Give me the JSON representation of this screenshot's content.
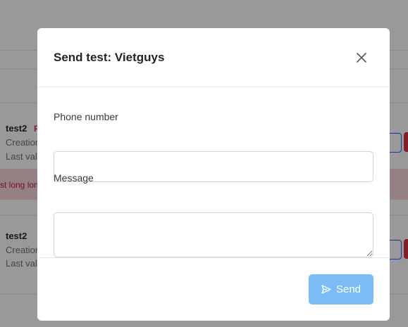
{
  "background": {
    "cards": [
      {
        "title": "test2",
        "tag": "F",
        "meta": [
          "Creation",
          "Last val"
        ],
        "error": "st long lon"
      },
      {
        "title": "test2",
        "meta": [
          "Creation",
          "Last val"
        ]
      }
    ]
  },
  "modal": {
    "title": "Send test: Vietguys",
    "close_icon": "close-icon",
    "phone": {
      "label": "Phone number",
      "value": "",
      "placeholder": ""
    },
    "message": {
      "label": "Message",
      "value": "",
      "placeholder": ""
    },
    "send": {
      "label": "Send",
      "icon": "send-icon"
    }
  },
  "colors": {
    "primary_disabled": "#7bbcf7",
    "danger": "#dc3545",
    "error_bg": "#f8d7da"
  }
}
